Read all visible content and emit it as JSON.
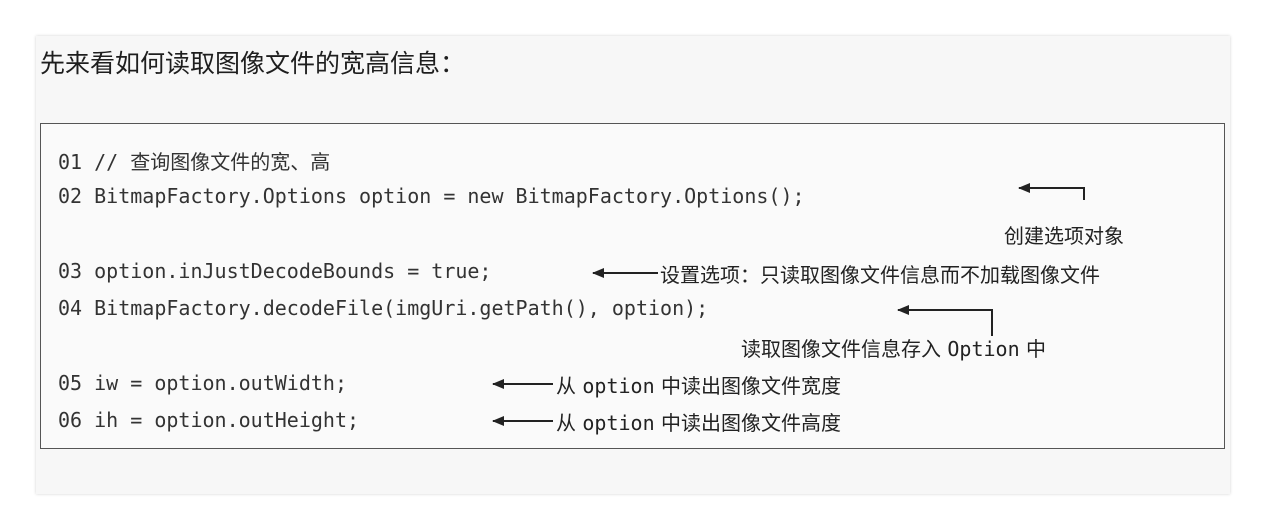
{
  "heading": "先来看如何读取图像文件的宽高信息：",
  "code_lines": [
    "01 // 查询图像文件的宽、高",
    "02 BitmapFactory.Options option = new BitmapFactory.Options();",
    "03 option.inJustDecodeBounds = true;",
    "04 BitmapFactory.decodeFile(imgUri.getPath(), option);",
    "05 iw = option.outWidth;",
    "06 ih = option.outHeight;"
  ],
  "annotations": {
    "line02": "创建选项对象",
    "line03": "设置选项：只读取图像文件信息而不加载图像文件",
    "line04_prefix": "读取图像文件信息存入 ",
    "line04_code": "Option",
    "line04_suffix": " 中",
    "line05_prefix": "从 ",
    "line05_code": "option",
    "line05_suffix": " 中读出图像文件宽度",
    "line06_prefix": "从 ",
    "line06_code": "option",
    "line06_suffix": " 中读出图像文件高度"
  }
}
